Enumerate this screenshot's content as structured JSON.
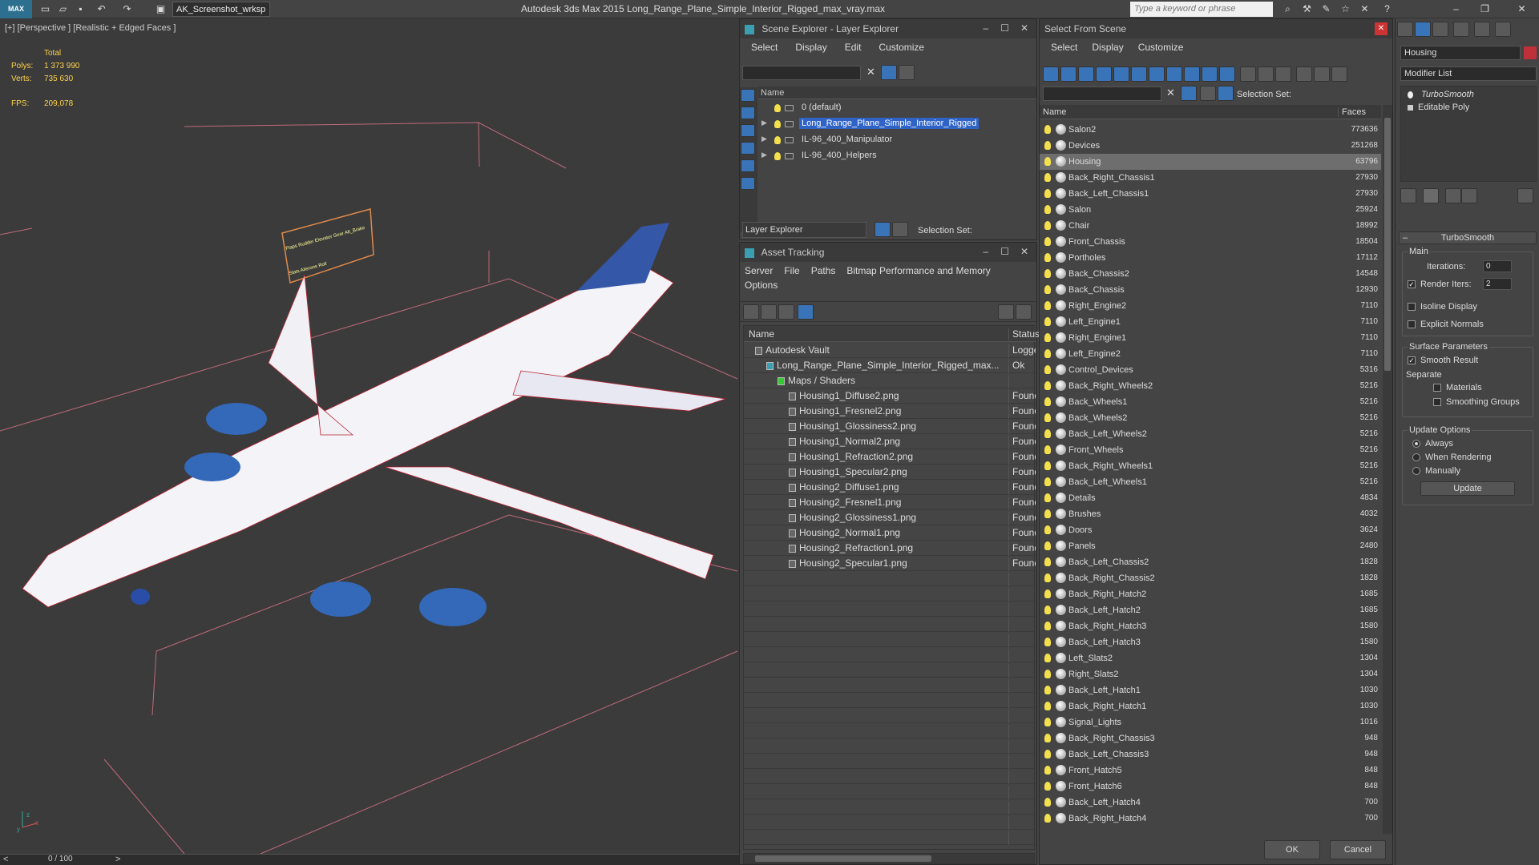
{
  "app": {
    "title": "Autodesk 3ds Max  2015     Long_Range_Plane_Simple_Interior_Rigged_max_vray.max",
    "workspace": "AK_Screenshot_wrksp",
    "search_placeholder": "Type a keyword or phrase",
    "logo": "MAX"
  },
  "viewport": {
    "label": "[+] [Perspective ] [Realistic + Edged Faces ]",
    "stats": {
      "total_label": "Total",
      "polys_label": "Polys:",
      "polys": "1 373 990",
      "verts_label": "Verts:",
      "verts": "735 630",
      "fps_label": "FPS:",
      "fps": "209,078"
    },
    "timeline": "0 / 100",
    "axis": {
      "x": "x",
      "y": "y",
      "z": "z"
    },
    "rig_panel": {
      "row1": [
        "Flaps",
        "Rudder",
        "Elevator",
        "Gear",
        "Alt_Brake"
      ],
      "row2": [
        "Slats",
        "Ailerons",
        "Roll"
      ]
    }
  },
  "scene_explorer": {
    "title": "Scene Explorer - Layer Explorer",
    "menu": [
      "Select",
      "Display",
      "Edit",
      "Customize"
    ],
    "col_name": "Name",
    "rows": [
      {
        "name": "0 (default)",
        "expand": false,
        "selected": false
      },
      {
        "name": "Long_Range_Plane_Simple_Interior_Rigged",
        "expand": true,
        "selected": true
      },
      {
        "name": "IL-96_400_Manipulator",
        "expand": true,
        "selected": false
      },
      {
        "name": "IL-96_400_Helpers",
        "expand": true,
        "selected": false
      }
    ],
    "layer_dropdown": "Layer Explorer",
    "selection_set_label": "Selection Set:"
  },
  "asset_tracking": {
    "title": "Asset Tracking",
    "menu": [
      "Server",
      "File",
      "Paths",
      "Bitmap Performance and Memory"
    ],
    "menu2": "Options",
    "col_name": "Name",
    "col_status": "Status",
    "rows": [
      {
        "name": "Autodesk Vault",
        "status": "Logge",
        "indent": 0
      },
      {
        "name": "Long_Range_Plane_Simple_Interior_Rigged_max...",
        "status": "Ok",
        "indent": 1
      },
      {
        "name": "Maps / Shaders",
        "status": "",
        "indent": 2
      },
      {
        "name": "Housing1_Diffuse2.png",
        "status": "Found",
        "indent": 3
      },
      {
        "name": "Housing1_Fresnel2.png",
        "status": "Found",
        "indent": 3
      },
      {
        "name": "Housing1_Glossiness2.png",
        "status": "Found",
        "indent": 3
      },
      {
        "name": "Housing1_Normal2.png",
        "status": "Found",
        "indent": 3
      },
      {
        "name": "Housing1_Refraction2.png",
        "status": "Found",
        "indent": 3
      },
      {
        "name": "Housing1_Specular2.png",
        "status": "Found",
        "indent": 3
      },
      {
        "name": "Housing2_Diffuse1.png",
        "status": "Found",
        "indent": 3
      },
      {
        "name": "Housing2_Fresnel1.png",
        "status": "Found",
        "indent": 3
      },
      {
        "name": "Housing2_Glossiness1.png",
        "status": "Found",
        "indent": 3
      },
      {
        "name": "Housing2_Normal1.png",
        "status": "Found",
        "indent": 3
      },
      {
        "name": "Housing2_Refraction1.png",
        "status": "Found",
        "indent": 3
      },
      {
        "name": "Housing2_Specular1.png",
        "status": "Found",
        "indent": 3
      }
    ]
  },
  "select_from_scene": {
    "title": "Select From Scene",
    "menu": [
      "Select",
      "Display",
      "Customize"
    ],
    "selection_set_label": "Selection Set:",
    "col_name": "Name",
    "col_faces": "Faces",
    "rows": [
      {
        "name": "Salon2",
        "faces": "773636"
      },
      {
        "name": "Devices",
        "faces": "251268"
      },
      {
        "name": "Housing",
        "faces": "63796"
      },
      {
        "name": "Back_Right_Chassis1",
        "faces": "27930"
      },
      {
        "name": "Back_Left_Chassis1",
        "faces": "27930"
      },
      {
        "name": "Salon",
        "faces": "25924"
      },
      {
        "name": "Chair",
        "faces": "18992"
      },
      {
        "name": "Front_Chassis",
        "faces": "18504"
      },
      {
        "name": "Portholes",
        "faces": "17112"
      },
      {
        "name": "Back_Chassis2",
        "faces": "14548"
      },
      {
        "name": "Back_Chassis",
        "faces": "12930"
      },
      {
        "name": "Right_Engine2",
        "faces": "7110"
      },
      {
        "name": "Left_Engine1",
        "faces": "7110"
      },
      {
        "name": "Right_Engine1",
        "faces": "7110"
      },
      {
        "name": "Left_Engine2",
        "faces": "7110"
      },
      {
        "name": "Control_Devices",
        "faces": "5316"
      },
      {
        "name": "Back_Right_Wheels2",
        "faces": "5216"
      },
      {
        "name": "Back_Wheels1",
        "faces": "5216"
      },
      {
        "name": "Back_Wheels2",
        "faces": "5216"
      },
      {
        "name": "Back_Left_Wheels2",
        "faces": "5216"
      },
      {
        "name": "Front_Wheels",
        "faces": "5216"
      },
      {
        "name": "Back_Right_Wheels1",
        "faces": "5216"
      },
      {
        "name": "Back_Left_Wheels1",
        "faces": "5216"
      },
      {
        "name": "Details",
        "faces": "4834"
      },
      {
        "name": "Brushes",
        "faces": "4032"
      },
      {
        "name": "Doors",
        "faces": "3624"
      },
      {
        "name": "Panels",
        "faces": "2480"
      },
      {
        "name": "Back_Left_Chassis2",
        "faces": "1828"
      },
      {
        "name": "Back_Right_Chassis2",
        "faces": "1828"
      },
      {
        "name": "Back_Right_Hatch2",
        "faces": "1685"
      },
      {
        "name": "Back_Left_Hatch2",
        "faces": "1685"
      },
      {
        "name": "Back_Right_Hatch3",
        "faces": "1580"
      },
      {
        "name": "Back_Left_Hatch3",
        "faces": "1580"
      },
      {
        "name": "Left_Slats2",
        "faces": "1304"
      },
      {
        "name": "Right_Slats2",
        "faces": "1304"
      },
      {
        "name": "Back_Left_Hatch1",
        "faces": "1030"
      },
      {
        "name": "Back_Right_Hatch1",
        "faces": "1030"
      },
      {
        "name": "Signal_Lights",
        "faces": "1016"
      },
      {
        "name": "Back_Right_Chassis3",
        "faces": "948"
      },
      {
        "name": "Back_Left_Chassis3",
        "faces": "948"
      },
      {
        "name": "Front_Hatch5",
        "faces": "848"
      },
      {
        "name": "Front_Hatch6",
        "faces": "848"
      },
      {
        "name": "Back_Left_Hatch4",
        "faces": "700"
      },
      {
        "name": "Back_Right_Hatch4",
        "faces": "700"
      }
    ],
    "selected_row": "Housing",
    "ok": "OK",
    "cancel": "Cancel"
  },
  "modifier_panel": {
    "object_name": "Housing",
    "modifier_list": "Modifier List",
    "stack": [
      "TurboSmooth",
      "Editable Poly"
    ],
    "rollout": "TurboSmooth",
    "main": "Main",
    "iterations_label": "Iterations:",
    "iterations": "0",
    "render_iters_label": "Render Iters:",
    "render_iters": "2",
    "isoline": "Isoline Display",
    "explicit_normals": "Explicit Normals",
    "surface_params": "Surface Parameters",
    "smooth_result": "Smooth Result",
    "separate": "Separate",
    "materials": "Materials",
    "smoothing_groups": "Smoothing Groups",
    "update_options": "Update Options",
    "always": "Always",
    "when_rendering": "When Rendering",
    "manually": "Manually",
    "update_btn": "Update"
  },
  "colors": {
    "accent": "#3a74b8",
    "selected_row": "#6e6e6e",
    "stat_text": "#ffd24a"
  }
}
